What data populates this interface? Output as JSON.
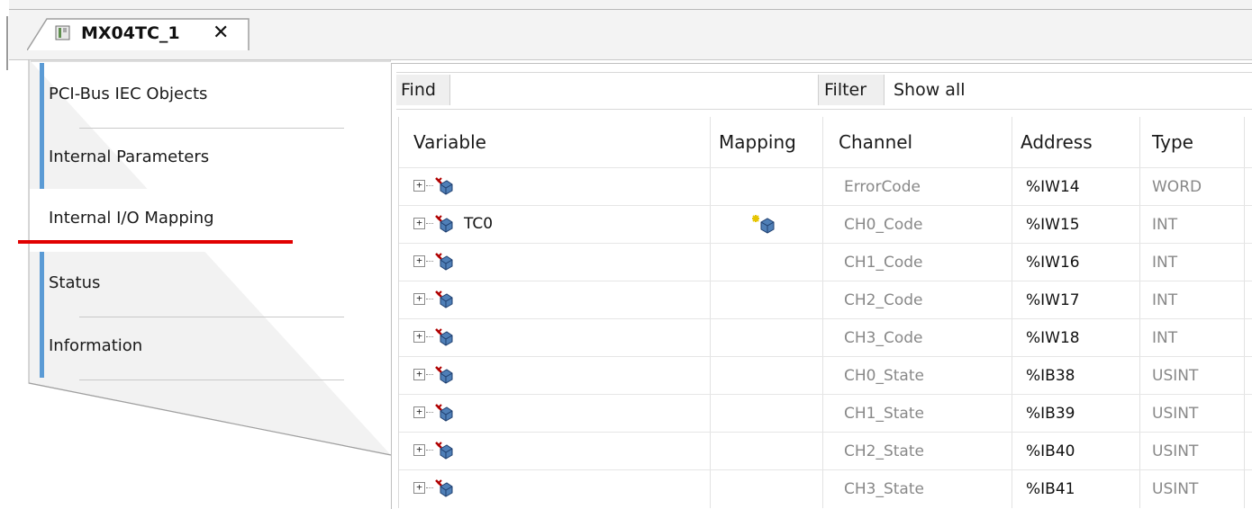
{
  "editor_tab": {
    "title": "MX04TC_1",
    "close_icon": "close-icon",
    "icon": "device-icon"
  },
  "nav": {
    "items": [
      {
        "label": "PCI-Bus IEC Objects",
        "active": false
      },
      {
        "label": "Internal Parameters",
        "active": false
      },
      {
        "label": "Internal I/O Mapping",
        "active": true
      },
      {
        "label": "Status",
        "active": false
      },
      {
        "label": "Information",
        "active": false
      }
    ],
    "accent_color": "#5b9bd5",
    "highlight_color": "#e10000"
  },
  "toolbar": {
    "find_label": "Find",
    "find_value": "",
    "filter_label": "Filter",
    "filter_value": "Show all"
  },
  "table": {
    "headers": {
      "variable": "Variable",
      "mapping": "Mapping",
      "channel": "Channel",
      "address": "Address",
      "type": "Type"
    },
    "rows": [
      {
        "variable": "",
        "mapping": false,
        "channel": "ErrorCode",
        "address": "%IW14",
        "type": "WORD"
      },
      {
        "variable": "TC0",
        "mapping": true,
        "channel": "CH0_Code",
        "address": "%IW15",
        "type": "INT"
      },
      {
        "variable": "",
        "mapping": false,
        "channel": "CH1_Code",
        "address": "%IW16",
        "type": "INT"
      },
      {
        "variable": "",
        "mapping": false,
        "channel": "CH2_Code",
        "address": "%IW17",
        "type": "INT"
      },
      {
        "variable": "",
        "mapping": false,
        "channel": "CH3_Code",
        "address": "%IW18",
        "type": "INT"
      },
      {
        "variable": "",
        "mapping": false,
        "channel": "CH0_State",
        "address": "%IB38",
        "type": "USINT"
      },
      {
        "variable": "",
        "mapping": false,
        "channel": "CH1_State",
        "address": "%IB39",
        "type": "USINT"
      },
      {
        "variable": "",
        "mapping": false,
        "channel": "CH2_State",
        "address": "%IB40",
        "type": "USINT"
      },
      {
        "variable": "",
        "mapping": false,
        "channel": "CH3_State",
        "address": "%IB41",
        "type": "USINT"
      }
    ]
  },
  "icons": {
    "expand": "expand-plus-icon",
    "input_variable": "input-variable-icon",
    "mapping": "new-variable-mapping-icon"
  }
}
